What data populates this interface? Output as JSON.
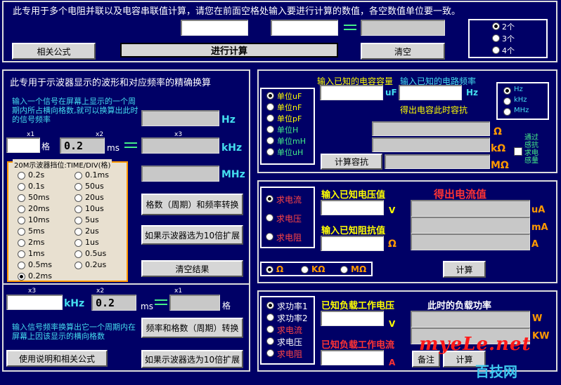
{
  "top": {
    "desc": "此专用于多个电阻并联以及电容串联值计算，请您在前面空格处输入要进行计算的数值，各空数值单位要一致。",
    "formula_btn": "相关公式",
    "calc_btn": "进行计算",
    "clear_btn": "清空",
    "count_options": [
      "2个",
      "3个",
      "4个"
    ]
  },
  "osc": {
    "title": "此专用于示波器显示的波形和对应频率的精确换算",
    "hint1": "输入一个信号在屏幕上显示的一个周期内所占横向格数,就可以换算出此时的信号频率",
    "x1": "x1",
    "x2": "x2",
    "x3": "x3",
    "grid_unit": "格",
    "ms_unit": "ms",
    "time_value": "0.2",
    "hz": "Hz",
    "khz": "kHz",
    "mhz": "MHz",
    "range_title": "20M示波器挡位:TIME/DIV(格)",
    "ranges_left": [
      "0.2s",
      "0.1s",
      "50ms",
      "20ms",
      "10ms",
      "5ms",
      "2ms",
      "1ms",
      "0.5ms",
      "0.2ms"
    ],
    "ranges_right": [
      "0.1ms",
      "50us",
      "20us",
      "10us",
      "5us",
      "2us",
      "1us",
      "0.5us",
      "0.2us"
    ],
    "convert_btn": "格数（周期）和频率转换",
    "x10_btn": "如果示波器选为10倍扩展",
    "clear_btn": "清空结果",
    "b_x3": "x3",
    "b_x2": "x2",
    "b_x1": "x1",
    "b_khz": "kHz",
    "b_time_value": "0.2",
    "b_ms": "ms",
    "b_grid": "格",
    "hint2": "输入信号频率换算出它一个周期内在屏幕上因该显示的横向格数",
    "b_convert_btn": "频率和格数（周期）转换",
    "b_x10_btn": "如果示波器选为10倍扩展",
    "help_btn": "使用说明和相关公式"
  },
  "cap": {
    "units": [
      "单位uF",
      "单位nF",
      "单位pF",
      "单位H",
      "单位mH",
      "单位uH"
    ],
    "cap_label": "输入已知的电容容量",
    "cap_unit": "uF",
    "freq_label": "输入已知的电路频率",
    "freq_unit": "Hz",
    "result_label": "得出电容此时容抗",
    "freq_units": [
      "Hz",
      "kHz",
      "MHz"
    ],
    "ohm": "Ω",
    "kohm": "kΩ",
    "mohm": "MΩ",
    "inductive": "通过感抗求电感量",
    "calc_btn": "计算容抗"
  },
  "ohm": {
    "modes": [
      "求电流",
      "求电压",
      "求电阻"
    ],
    "v_label": "输入已知电压值",
    "v_unit": "V",
    "r_label": "输入已知阻抗值",
    "r_unit": "Ω",
    "result_title": "得出电流值",
    "ua": "uA",
    "ma": "mA",
    "a": "A",
    "r_units": [
      "Ω",
      "KΩ",
      "MΩ"
    ],
    "calc_btn": "计算"
  },
  "power": {
    "modes": [
      "求功率1",
      "求功率2",
      "求电流",
      "求电压",
      "求电阻"
    ],
    "v_label": "已知负载工作电压",
    "v_unit": "V",
    "i_label": "已知负载工作电流",
    "i_unit": "A",
    "result_title": "此时的负载功率",
    "w": "W",
    "kw": "KW",
    "note_btn": "备注",
    "calc_btn": "计算"
  },
  "watermark": {
    "logo": "myeLe.net",
    "cn": "百技网"
  }
}
